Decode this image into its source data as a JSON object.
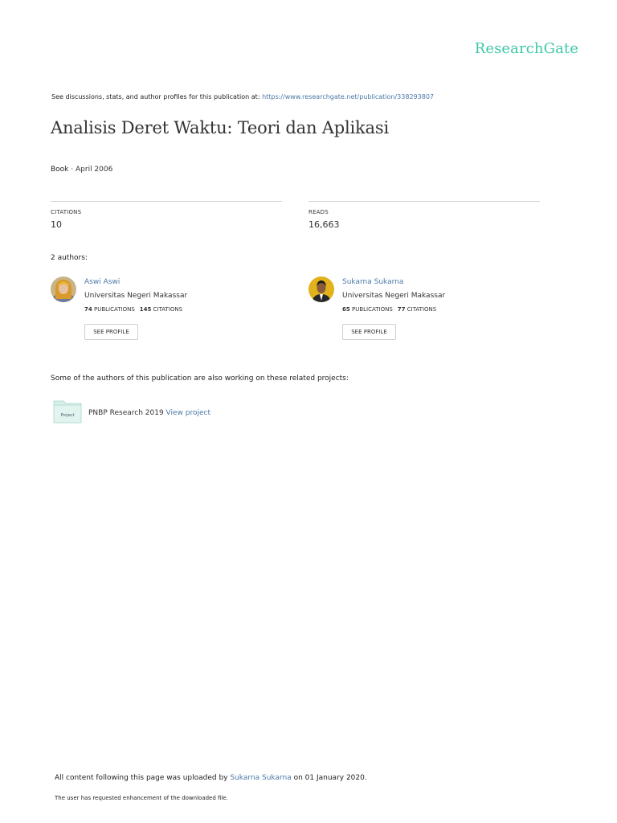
{
  "brand": "ResearchGate",
  "header": {
    "see_prefix": "See discussions, stats, and author profiles for this publication at: ",
    "see_url": "https://www.researchgate.net/publication/338293807"
  },
  "publication": {
    "title": "Analisis Deret Waktu: Teori dan Aplikasi",
    "type": "Book",
    "sep": " · ",
    "date": "April 2006"
  },
  "stats": {
    "citations_label": "CITATIONS",
    "citations_value": "10",
    "reads_label": "READS",
    "reads_value": "16,663"
  },
  "authors_heading": "2 authors:",
  "authors": [
    {
      "name": "Aswi Aswi",
      "institution": "Universitas Negeri Makassar",
      "publications": "74",
      "publications_label": "PUBLICATIONS",
      "citations": "145",
      "citations_label": "CITATIONS",
      "button": "SEE PROFILE"
    },
    {
      "name": "Sukarna Sukarna",
      "institution": "Universitas Negeri Makassar",
      "publications": "65",
      "publications_label": "PUBLICATIONS",
      "citations": "77",
      "citations_label": "CITATIONS",
      "button": "SEE PROFILE"
    }
  ],
  "related": {
    "heading": "Some of the authors of this publication are also working on these related projects:",
    "icon_label": "Project",
    "project_name": "PNBP Research 2019 ",
    "project_link": "View project"
  },
  "footer": {
    "upload_prefix": "All content following this page was uploaded by ",
    "uploader": "Sukarna Sukarna",
    "upload_suffix": " on 01 January 2020.",
    "enhancement": "The user has requested enhancement of the downloaded file."
  },
  "colors": {
    "brand": "#3ec7a6",
    "link": "#4a78a8"
  }
}
